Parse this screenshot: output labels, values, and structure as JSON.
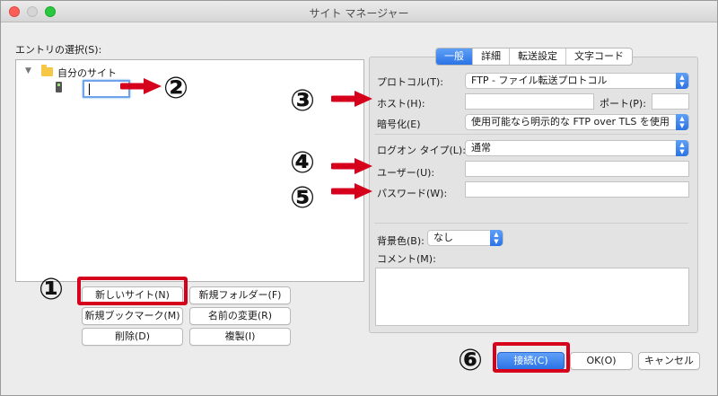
{
  "window": {
    "title": "サイト マネージャー"
  },
  "left": {
    "entries_label": "エントリの選択(S):",
    "tree": {
      "root_label": "自分のサイト",
      "editing_value": ""
    }
  },
  "buttons": {
    "new_site": "新しいサイト(N)",
    "new_folder": "新規フォルダー(F)",
    "new_bookmark": "新規ブックマーク(M)",
    "rename": "名前の変更(R)",
    "delete": "削除(D)",
    "duplicate": "複製(I)"
  },
  "tabs": [
    "一般",
    "詳細",
    "転送設定",
    "文字コード"
  ],
  "form": {
    "protocol_label": "プロトコル(T):",
    "protocol_value": "FTP - ファイル転送プロトコル",
    "host_label": "ホスト(H):",
    "host_value": "",
    "port_label": "ポート(P):",
    "port_value": "",
    "encryption_label": "暗号化(E)",
    "encryption_value": "使用可能なら明示的な FTP over TLS を使用",
    "logon_type_label": "ログオン タイプ(L):",
    "logon_type_value": "通常",
    "user_label": "ユーザー(U):",
    "user_value": "",
    "password_label": "パスワード(W):",
    "password_value": "",
    "bgcolor_label": "背景色(B):",
    "bgcolor_value": "なし",
    "comment_label": "コメント(M):",
    "comment_value": ""
  },
  "footer": {
    "connect": "接続(C)",
    "ok": "OK(O)",
    "cancel": "キャンセル"
  },
  "annotations": {
    "n1": "①",
    "n2": "②",
    "n3": "③",
    "n4": "④",
    "n5": "⑤",
    "n6": "⑥",
    "color": "#d6001c"
  }
}
